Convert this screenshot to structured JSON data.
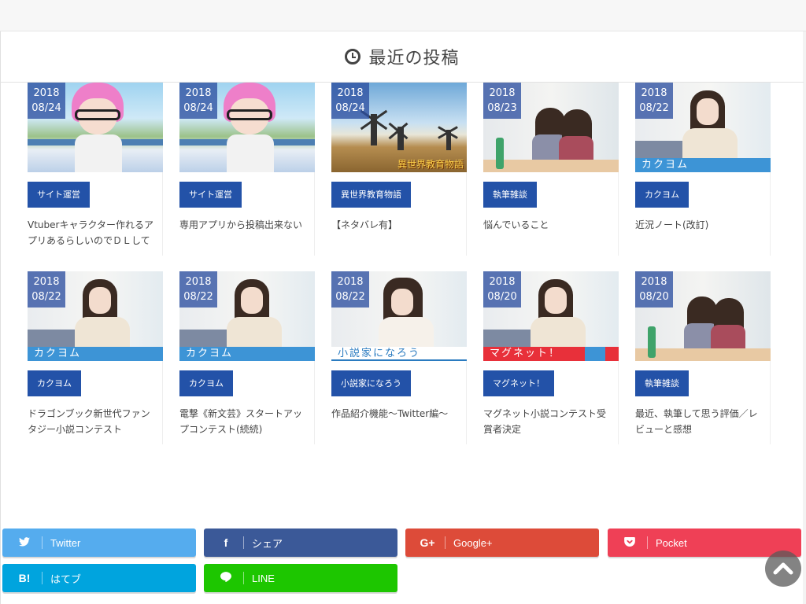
{
  "section": {
    "title": "最近の投稿"
  },
  "posts": [
    {
      "year": "2018",
      "date": "08/24",
      "category": "サイト運営",
      "title": "Vtuberキャラクター作れるアプリあるらしいのでＤＬして"
    },
    {
      "year": "2018",
      "date": "08/24",
      "category": "サイト運営",
      "title": "専用アプリから投稿出来ない"
    },
    {
      "year": "2018",
      "date": "08/24",
      "category": "異世界教育物語",
      "title": "【ネタバレ有】",
      "thumb_caption": "異世界教育物語"
    },
    {
      "year": "2018",
      "date": "08/23",
      "category": "執筆雑談",
      "title": "悩んでいること"
    },
    {
      "year": "2018",
      "date": "08/22",
      "category": "カクヨム",
      "title": "近況ノート(改訂)",
      "thumb_caption": "カクヨム"
    },
    {
      "year": "2018",
      "date": "08/22",
      "category": "カクヨム",
      "title": "ドラゴンブック新世代ファンタジー小説コンテスト",
      "thumb_caption": "カクヨム"
    },
    {
      "year": "2018",
      "date": "08/22",
      "category": "カクヨム",
      "title": "電撃《新文芸》スタートアップコンテスト(続続)",
      "thumb_caption": "カクヨム"
    },
    {
      "year": "2018",
      "date": "08/22",
      "category": "小説家になろう",
      "title": "作品紹介機能〜Twitter編〜",
      "thumb_caption": "小説家になろう"
    },
    {
      "year": "2018",
      "date": "08/20",
      "category": "マグネット！",
      "title": "マグネット小説コンテスト受賞者決定",
      "thumb_caption": "マグネット！"
    },
    {
      "year": "2018",
      "date": "08/20",
      "category": "執筆雑談",
      "title": "最近、執筆して思う評価／レビューと感想"
    }
  ],
  "share": {
    "twitter": "Twitter",
    "facebook": "シェア",
    "google": "Google+",
    "pocket": "Pocket",
    "hatena": "はてブ",
    "line": "LINE"
  },
  "icons": {
    "twitter": "twitter-icon",
    "facebook": "facebook-icon",
    "google": "google-plus-icon",
    "pocket": "pocket-icon",
    "hatena": "hatena-icon",
    "line": "line-icon",
    "clock": "clock-icon",
    "totop": "chevron-up-icon"
  },
  "colors": {
    "category_bg": "#2352a8",
    "date_badge_bg": "#2d50a0",
    "twitter": "#55acee",
    "facebook": "#3b5998",
    "google": "#dd4b39",
    "pocket": "#ef4056",
    "hatena": "#00a4de",
    "line": "#1dc600"
  }
}
